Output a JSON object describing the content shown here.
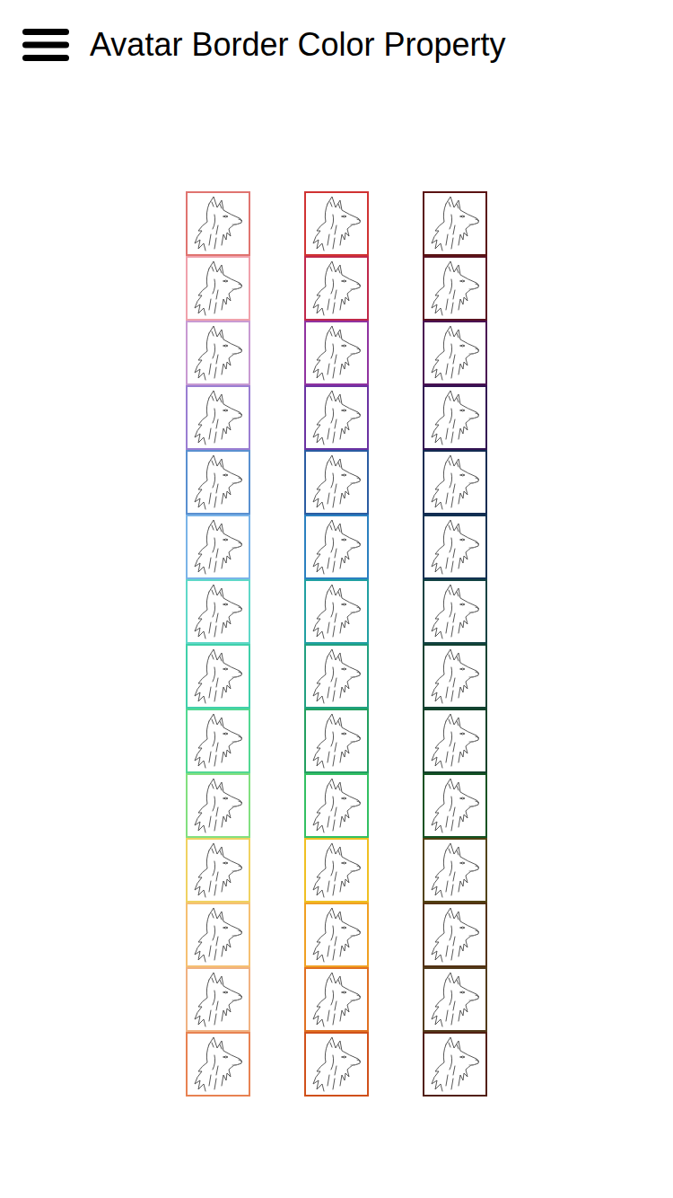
{
  "header": {
    "title": "Avatar Border Color Property"
  },
  "columns": [
    {
      "avatars": [
        {
          "color": "#e07470"
        },
        {
          "color": "#f0a2ac"
        },
        {
          "color": "#c89ad2"
        },
        {
          "color": "#9a7ed2"
        },
        {
          "color": "#5a90d0"
        },
        {
          "color": "#7ab4e8"
        },
        {
          "color": "#5fd8c8"
        },
        {
          "color": "#40d0aa"
        },
        {
          "color": "#52d892"
        },
        {
          "color": "#82e080"
        },
        {
          "color": "#f0d262"
        },
        {
          "color": "#f5c072"
        },
        {
          "color": "#f0b282"
        },
        {
          "color": "#e88252"
        }
      ]
    },
    {
      "avatars": [
        {
          "color": "#d03232"
        },
        {
          "color": "#c0284a"
        },
        {
          "color": "#9032a0"
        },
        {
          "color": "#6a32a2"
        },
        {
          "color": "#2a5ca2"
        },
        {
          "color": "#2a80c0"
        },
        {
          "color": "#20a0a2"
        },
        {
          "color": "#20a080"
        },
        {
          "color": "#22a060"
        },
        {
          "color": "#32c062"
        },
        {
          "color": "#f0c022"
        },
        {
          "color": "#f0a022"
        },
        {
          "color": "#e07022"
        },
        {
          "color": "#d0501a"
        }
      ]
    },
    {
      "avatars": [
        {
          "color": "#5a1212"
        },
        {
          "color": "#5a1222"
        },
        {
          "color": "#4a1252"
        },
        {
          "color": "#321252"
        },
        {
          "color": "#122c52"
        },
        {
          "color": "#123252"
        },
        {
          "color": "#124242"
        },
        {
          "color": "#124232"
        },
        {
          "color": "#12422a"
        },
        {
          "color": "#125222"
        },
        {
          "color": "#524212"
        },
        {
          "color": "#523212"
        },
        {
          "color": "#523a1a"
        },
        {
          "color": "#522012"
        }
      ]
    }
  ]
}
